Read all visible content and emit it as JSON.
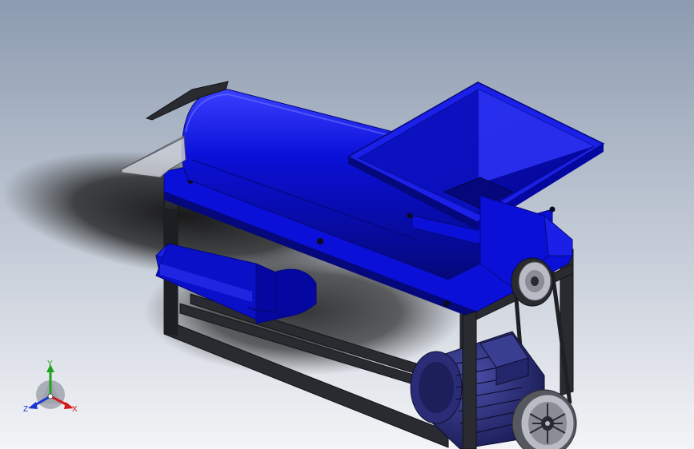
{
  "view": {
    "background_top": "#8c9bb0",
    "background_bottom": "#f3f4f7",
    "shadow_color": "#101010"
  },
  "colors": {
    "body_blue": "#0b10d8",
    "body_blue_dark": "#05087a",
    "body_blue_light": "#3a40ff",
    "frame": "#2a2b31",
    "frame_dark": "#121317",
    "motor": "#2a2c77",
    "pulley": "#b9bcc4",
    "belt": "#1f2024",
    "tray": "#55585f"
  },
  "triad": {
    "x_label": "X",
    "y_label": "Y",
    "z_label": "Z",
    "x_color": "#d21b1b",
    "y_color": "#1fa31f",
    "z_color": "#1b36d2"
  }
}
